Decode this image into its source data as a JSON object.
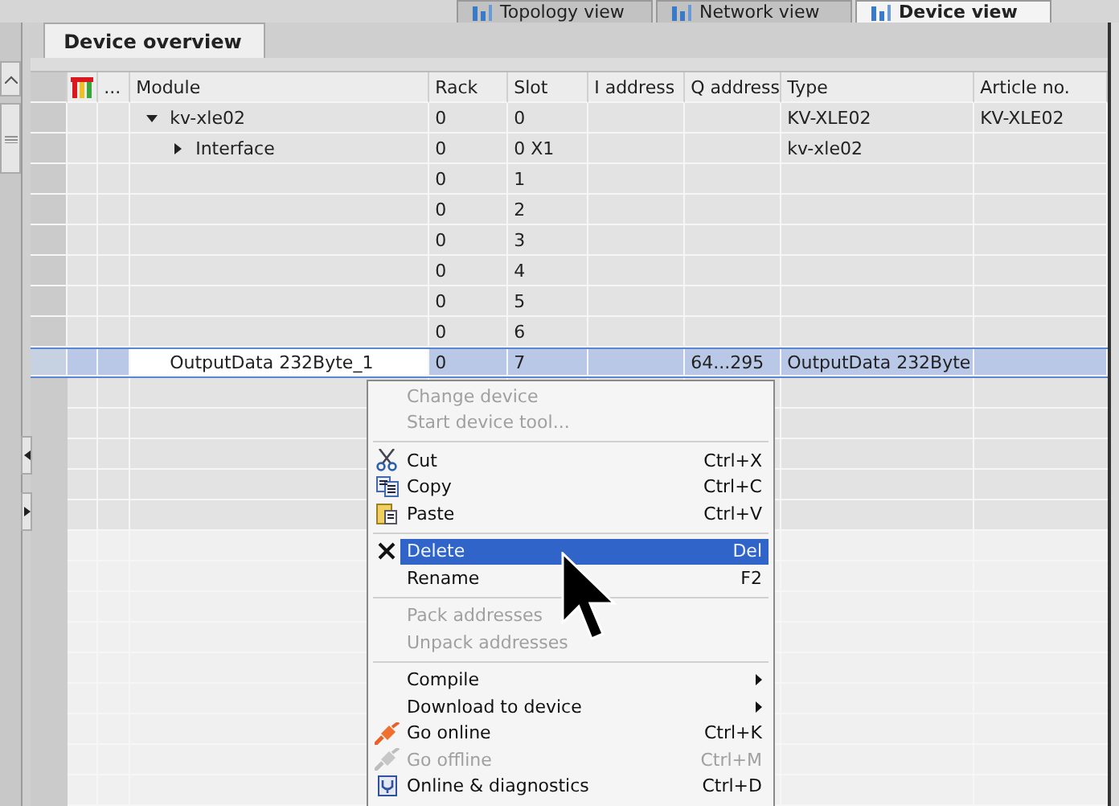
{
  "view_tabs": [
    {
      "label": "Topology view",
      "selected": false
    },
    {
      "label": "Network view",
      "selected": false
    },
    {
      "label": "Device view",
      "selected": true
    }
  ],
  "panel_tab": {
    "label": "Device overview"
  },
  "table": {
    "dots": "...",
    "columns": [
      "Module",
      "Rack",
      "Slot",
      "I address",
      "Q address",
      "Type",
      "Article no."
    ],
    "rows": [
      {
        "module": "kv-xle02",
        "expanded": true,
        "rack": "0",
        "slot": "0",
        "type": "KV-XLE02",
        "article_no": "KV-XLE02",
        "selected": false,
        "children": [
          {
            "module": "Interface",
            "expanded": false,
            "rack": "0",
            "slot": "0 X1",
            "type": "kv-xle02",
            "selected": false
          }
        ]
      },
      {
        "rack": "0",
        "slot": "1",
        "selected": false
      },
      {
        "rack": "0",
        "slot": "2",
        "selected": false
      },
      {
        "rack": "0",
        "slot": "3",
        "selected": false
      },
      {
        "rack": "0",
        "slot": "4",
        "selected": false
      },
      {
        "rack": "0",
        "slot": "5",
        "selected": false
      },
      {
        "rack": "0",
        "slot": "6",
        "selected": false
      },
      {
        "module": "OutputData 232Byte_1",
        "rack": "0",
        "slot": "7",
        "q_address": "64...295",
        "type": "OutputData 232Byte",
        "selected": true
      }
    ]
  },
  "context_menu": [
    {
      "kind": "plain",
      "label": "Change device",
      "disabled": true,
      "selected": false
    },
    {
      "kind": "plain",
      "label": "Start device tool...",
      "disabled": true,
      "selected": false
    },
    {
      "kind": "separator"
    },
    {
      "kind": "cut",
      "label": "Cut",
      "shortcut": "Ctrl+X",
      "disabled": false,
      "selected": false
    },
    {
      "kind": "copy",
      "label": "Copy",
      "shortcut": "Ctrl+C",
      "disabled": false,
      "selected": false
    },
    {
      "kind": "paste",
      "label": "Paste",
      "shortcut": "Ctrl+V",
      "disabled": false,
      "selected": false
    },
    {
      "kind": "separator"
    },
    {
      "kind": "delete",
      "label": "Delete",
      "shortcut": "Del",
      "disabled": false,
      "selected": true
    },
    {
      "kind": "plain",
      "label": "Rename",
      "shortcut": "F2",
      "disabled": false,
      "selected": false
    },
    {
      "kind": "separator"
    },
    {
      "kind": "plain",
      "label": "Pack addresses",
      "disabled": true,
      "selected": false
    },
    {
      "kind": "plain",
      "label": "Unpack addresses",
      "disabled": true,
      "selected": false
    },
    {
      "kind": "separator"
    },
    {
      "kind": "submenu",
      "label": "Compile",
      "disabled": false,
      "selected": false
    },
    {
      "kind": "submenu",
      "label": "Download to device",
      "disabled": false,
      "selected": false
    },
    {
      "kind": "online",
      "label": "Go online",
      "shortcut": "Ctrl+K",
      "disabled": false,
      "selected": false
    },
    {
      "kind": "offline",
      "label": "Go offline",
      "shortcut": "Ctrl+M",
      "disabled": true,
      "selected": false
    },
    {
      "kind": "diagnostics",
      "label": "Online & diagnostics",
      "shortcut": "Ctrl+D",
      "disabled": false,
      "selected": false
    }
  ]
}
